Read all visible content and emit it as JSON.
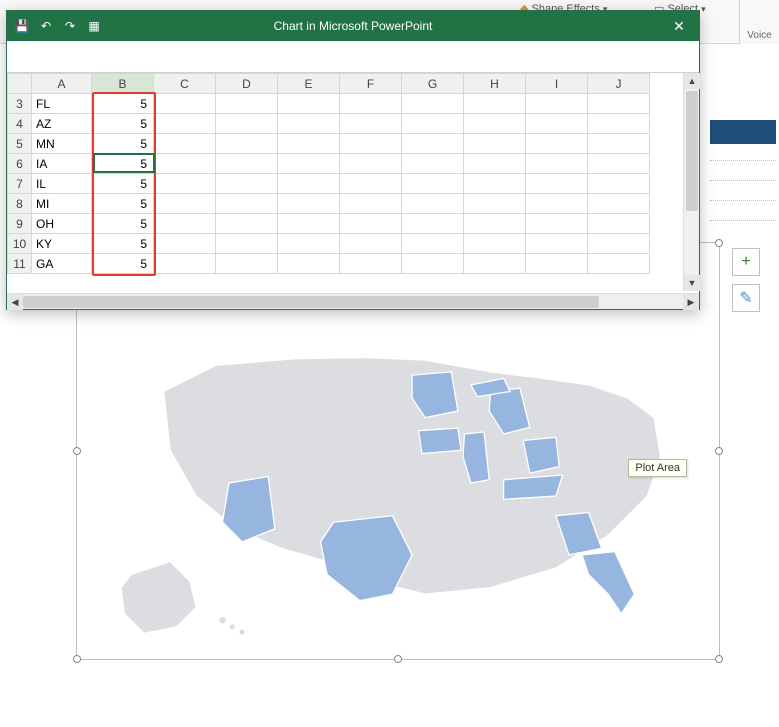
{
  "ribbon": {
    "shape_effects": "Shape Effects",
    "select": "Select",
    "voice": "Voice"
  },
  "excel": {
    "title": "Chart in Microsoft PowerPoint",
    "close": "✕",
    "columns": [
      "A",
      "B",
      "C",
      "D",
      "E",
      "F",
      "G",
      "H",
      "I",
      "J"
    ],
    "rows": [
      {
        "n": "3",
        "a": "FL",
        "b": "5"
      },
      {
        "n": "4",
        "a": "AZ",
        "b": "5"
      },
      {
        "n": "5",
        "a": "MN",
        "b": "5"
      },
      {
        "n": "6",
        "a": "IA",
        "b": "5"
      },
      {
        "n": "7",
        "a": "IL",
        "b": "5"
      },
      {
        "n": "8",
        "a": "MI",
        "b": "5"
      },
      {
        "n": "9",
        "a": "OH",
        "b": "5"
      },
      {
        "n": "10",
        "a": "KY",
        "b": "5"
      },
      {
        "n": "11",
        "a": "GA",
        "b": "5"
      }
    ],
    "active_cell": "B6"
  },
  "chart": {
    "tooltip": "Plot Area"
  },
  "chart_data": {
    "type": "map",
    "region": "United States",
    "title": "",
    "legend": null,
    "series": [
      {
        "name": "",
        "data": [
          {
            "state": "FL",
            "value": 5
          },
          {
            "state": "AZ",
            "value": 5
          },
          {
            "state": "MN",
            "value": 5
          },
          {
            "state": "IA",
            "value": 5
          },
          {
            "state": "IL",
            "value": 5
          },
          {
            "state": "MI",
            "value": 5
          },
          {
            "state": "OH",
            "value": 5
          },
          {
            "state": "KY",
            "value": 5
          },
          {
            "state": "GA",
            "value": 5
          },
          {
            "state": "TX",
            "value": 5
          }
        ]
      }
    ],
    "highlighted_color": "#96b6e0",
    "default_color": "#dcdde0"
  },
  "float_buttons": {
    "add": "+",
    "brush": "✎"
  }
}
